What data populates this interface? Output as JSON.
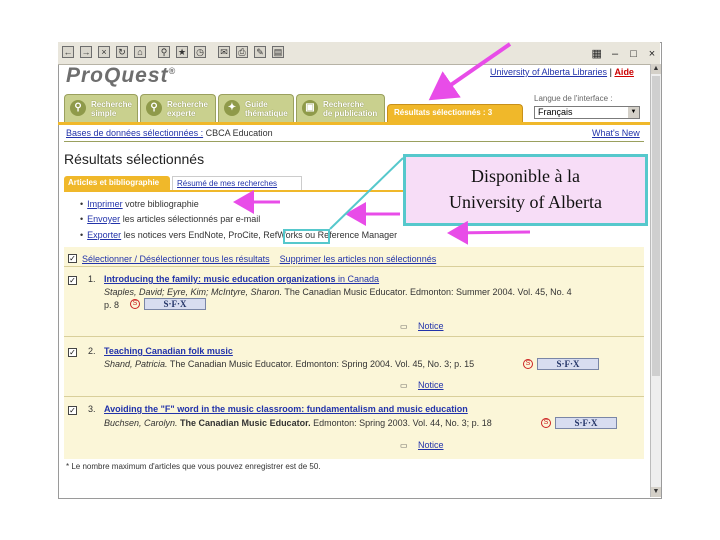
{
  "toolbar": {
    "icons": [
      "back-icon",
      "forward-icon",
      "stop-icon",
      "refresh-icon",
      "home-icon",
      "search-icon",
      "favorites-icon",
      "history-icon",
      "mail-icon",
      "print-icon",
      "edit-icon",
      "discuss-icon"
    ]
  },
  "header": {
    "logo_text": "ProQuest",
    "logo_mark": "®",
    "institution": "University of Alberta Libraries",
    "link_sep": "|",
    "help": "Aide"
  },
  "tabs": [
    {
      "line1": "Recherche",
      "line2": "simple"
    },
    {
      "line1": "Recherche",
      "line2": "experte"
    },
    {
      "line1": "Guide",
      "line2": "thématique"
    },
    {
      "line1": "Recherche",
      "line2": "de publication"
    }
  ],
  "selected_tab": {
    "label": "Résultats sélectionnés : 3 articles"
  },
  "language": {
    "label": "Langue de l'interface :",
    "value": "Français"
  },
  "databases": {
    "label": "Bases de données sélectionnées :",
    "value": "CBCA Education",
    "whats_new": "What's New"
  },
  "page_title": "Résultats sélectionnés",
  "subtabs": {
    "active": "Articles et bibliographie",
    "inactive": "Résumé de mes recherches"
  },
  "actions": [
    {
      "link": "Imprimer",
      "rest": "votre bibliographie"
    },
    {
      "link": "Envoyer",
      "rest": "les articles sélectionnés par e-mail"
    },
    {
      "link": "Exporter",
      "rest": "les notices vers EndNote, ProCite, RefWorks ou Reference Manager"
    }
  ],
  "selection": {
    "select_all": "Sélectionner / Désélectionner tous les résultats",
    "delete": "Supprimer les articles non sélectionnés"
  },
  "results": [
    {
      "num": "1.",
      "title": "Introducing the family: music education organizations",
      "title_rest": " in Canada",
      "authors": "Staples, David; Eyre, Kim; McIntyre, Sharon.",
      "publication": " The Canadian Music Educator.",
      "details": " Edmonton: Summer 2004. Vol. 45, No. 4",
      "details2": "p. 8",
      "notice": "Notice"
    },
    {
      "num": "2.",
      "title": "Teaching Canadian folk music",
      "title_rest": "",
      "authors": "Shand, Patricia.",
      "publication": " The Canadian Music Educator.",
      "details": " Edmonton: Spring 2004. Vol. 45, No. 3; p. 15",
      "details2": "",
      "notice": "Notice"
    },
    {
      "num": "3.",
      "title": "Avoiding the \"F\" word in the music classroom: fundamentalism and music education",
      "title_rest": "",
      "authors": "Buchsen, Carolyn.",
      "publication": " The Canadian Music Educator.",
      "details": " Edmonton: Spring 2003. Vol. 44, No. 3; p. 18",
      "details2": "",
      "notice": "Notice"
    }
  ],
  "sfx_label": "S·F·X",
  "footnote": "* Le nombre maximum d'articles que vous pouvez enregistrer est de 50.",
  "callout": {
    "line1": "Disponible à la",
    "line2": "University of Alberta"
  },
  "colors": {
    "tab_green": "#c9d08e",
    "tab_orange": "#f0b82a",
    "link_blue": "#2233aa",
    "arrow_magenta": "#e84ce8",
    "callout_border": "#56c8cc",
    "callout_bg": "#f7ddf7",
    "results_bg": "#fbf6d8"
  }
}
